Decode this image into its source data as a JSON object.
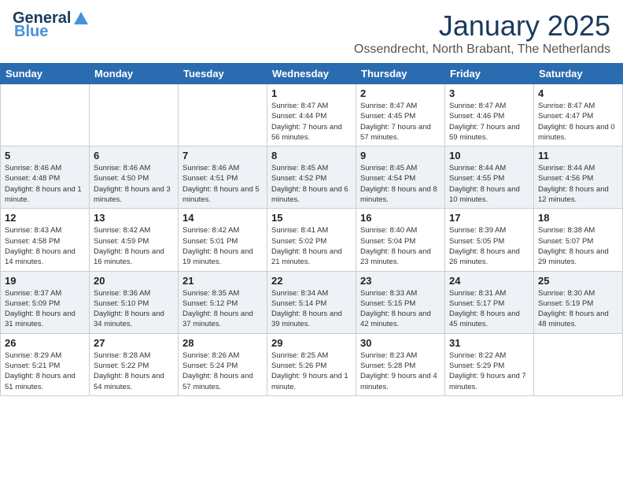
{
  "header": {
    "logo_general": "General",
    "logo_blue": "Blue",
    "month_year": "January 2025",
    "location": "Ossendrecht, North Brabant, The Netherlands"
  },
  "weekdays": [
    "Sunday",
    "Monday",
    "Tuesday",
    "Wednesday",
    "Thursday",
    "Friday",
    "Saturday"
  ],
  "weeks": [
    [
      {
        "day": "",
        "info": ""
      },
      {
        "day": "",
        "info": ""
      },
      {
        "day": "",
        "info": ""
      },
      {
        "day": "1",
        "info": "Sunrise: 8:47 AM\nSunset: 4:44 PM\nDaylight: 7 hours and 56 minutes."
      },
      {
        "day": "2",
        "info": "Sunrise: 8:47 AM\nSunset: 4:45 PM\nDaylight: 7 hours and 57 minutes."
      },
      {
        "day": "3",
        "info": "Sunrise: 8:47 AM\nSunset: 4:46 PM\nDaylight: 7 hours and 59 minutes."
      },
      {
        "day": "4",
        "info": "Sunrise: 8:47 AM\nSunset: 4:47 PM\nDaylight: 8 hours and 0 minutes."
      }
    ],
    [
      {
        "day": "5",
        "info": "Sunrise: 8:46 AM\nSunset: 4:48 PM\nDaylight: 8 hours and 1 minute."
      },
      {
        "day": "6",
        "info": "Sunrise: 8:46 AM\nSunset: 4:50 PM\nDaylight: 8 hours and 3 minutes."
      },
      {
        "day": "7",
        "info": "Sunrise: 8:46 AM\nSunset: 4:51 PM\nDaylight: 8 hours and 5 minutes."
      },
      {
        "day": "8",
        "info": "Sunrise: 8:45 AM\nSunset: 4:52 PM\nDaylight: 8 hours and 6 minutes."
      },
      {
        "day": "9",
        "info": "Sunrise: 8:45 AM\nSunset: 4:54 PM\nDaylight: 8 hours and 8 minutes."
      },
      {
        "day": "10",
        "info": "Sunrise: 8:44 AM\nSunset: 4:55 PM\nDaylight: 8 hours and 10 minutes."
      },
      {
        "day": "11",
        "info": "Sunrise: 8:44 AM\nSunset: 4:56 PM\nDaylight: 8 hours and 12 minutes."
      }
    ],
    [
      {
        "day": "12",
        "info": "Sunrise: 8:43 AM\nSunset: 4:58 PM\nDaylight: 8 hours and 14 minutes."
      },
      {
        "day": "13",
        "info": "Sunrise: 8:42 AM\nSunset: 4:59 PM\nDaylight: 8 hours and 16 minutes."
      },
      {
        "day": "14",
        "info": "Sunrise: 8:42 AM\nSunset: 5:01 PM\nDaylight: 8 hours and 19 minutes."
      },
      {
        "day": "15",
        "info": "Sunrise: 8:41 AM\nSunset: 5:02 PM\nDaylight: 8 hours and 21 minutes."
      },
      {
        "day": "16",
        "info": "Sunrise: 8:40 AM\nSunset: 5:04 PM\nDaylight: 8 hours and 23 minutes."
      },
      {
        "day": "17",
        "info": "Sunrise: 8:39 AM\nSunset: 5:05 PM\nDaylight: 8 hours and 26 minutes."
      },
      {
        "day": "18",
        "info": "Sunrise: 8:38 AM\nSunset: 5:07 PM\nDaylight: 8 hours and 29 minutes."
      }
    ],
    [
      {
        "day": "19",
        "info": "Sunrise: 8:37 AM\nSunset: 5:09 PM\nDaylight: 8 hours and 31 minutes."
      },
      {
        "day": "20",
        "info": "Sunrise: 8:36 AM\nSunset: 5:10 PM\nDaylight: 8 hours and 34 minutes."
      },
      {
        "day": "21",
        "info": "Sunrise: 8:35 AM\nSunset: 5:12 PM\nDaylight: 8 hours and 37 minutes."
      },
      {
        "day": "22",
        "info": "Sunrise: 8:34 AM\nSunset: 5:14 PM\nDaylight: 8 hours and 39 minutes."
      },
      {
        "day": "23",
        "info": "Sunrise: 8:33 AM\nSunset: 5:15 PM\nDaylight: 8 hours and 42 minutes."
      },
      {
        "day": "24",
        "info": "Sunrise: 8:31 AM\nSunset: 5:17 PM\nDaylight: 8 hours and 45 minutes."
      },
      {
        "day": "25",
        "info": "Sunrise: 8:30 AM\nSunset: 5:19 PM\nDaylight: 8 hours and 48 minutes."
      }
    ],
    [
      {
        "day": "26",
        "info": "Sunrise: 8:29 AM\nSunset: 5:21 PM\nDaylight: 8 hours and 51 minutes."
      },
      {
        "day": "27",
        "info": "Sunrise: 8:28 AM\nSunset: 5:22 PM\nDaylight: 8 hours and 54 minutes."
      },
      {
        "day": "28",
        "info": "Sunrise: 8:26 AM\nSunset: 5:24 PM\nDaylight: 8 hours and 57 minutes."
      },
      {
        "day": "29",
        "info": "Sunrise: 8:25 AM\nSunset: 5:26 PM\nDaylight: 9 hours and 1 minute."
      },
      {
        "day": "30",
        "info": "Sunrise: 8:23 AM\nSunset: 5:28 PM\nDaylight: 9 hours and 4 minutes."
      },
      {
        "day": "31",
        "info": "Sunrise: 8:22 AM\nSunset: 5:29 PM\nDaylight: 9 hours and 7 minutes."
      },
      {
        "day": "",
        "info": ""
      }
    ]
  ]
}
